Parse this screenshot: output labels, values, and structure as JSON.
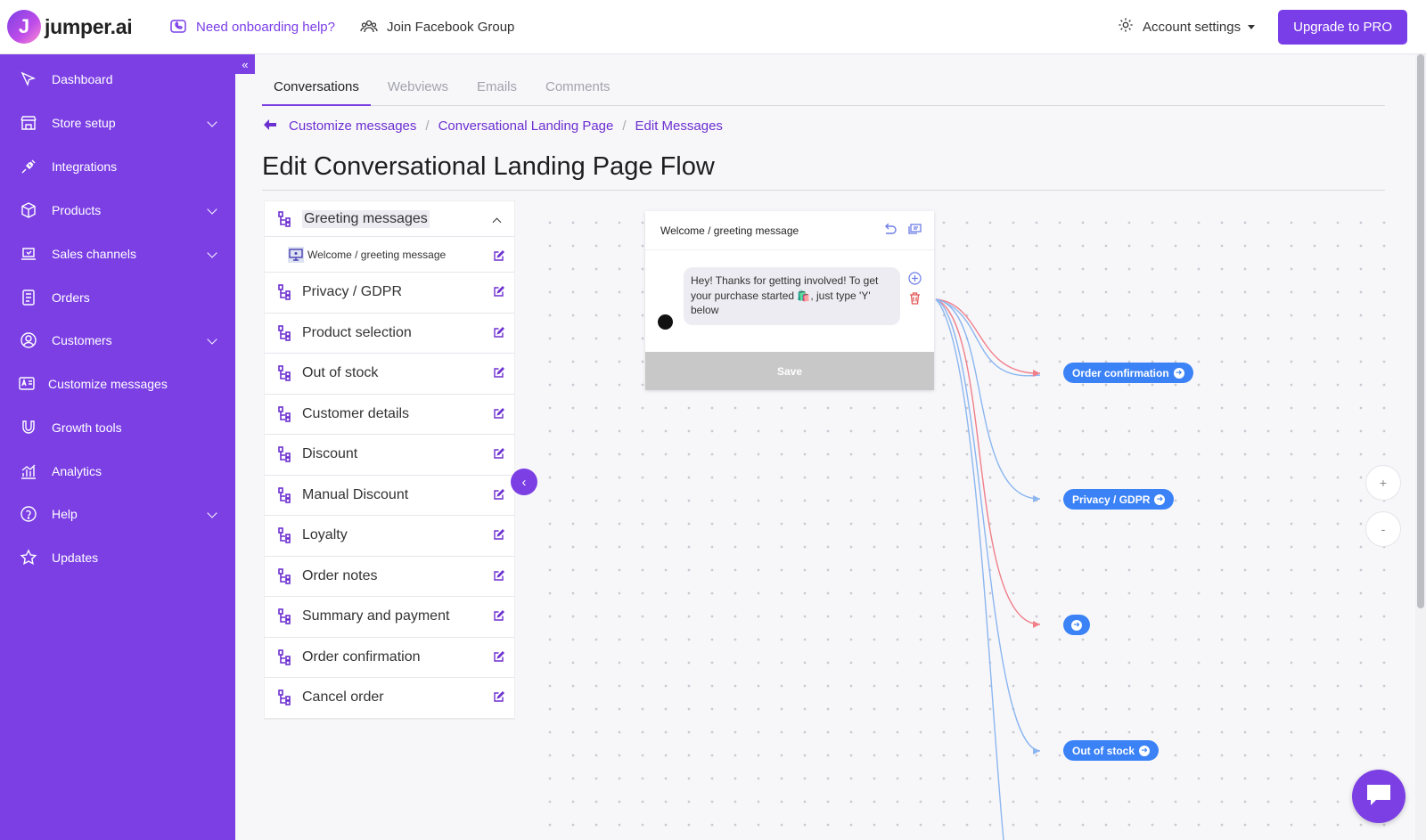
{
  "topbar": {
    "logo_text": "jumper.ai",
    "logo_letter": "J",
    "onboarding_link": "Need onboarding help?",
    "facebook_link": "Join Facebook Group",
    "account_settings": "Account settings",
    "upgrade_button": "Upgrade to PRO"
  },
  "sidebar": {
    "collapse_glyph": "«",
    "items": [
      {
        "label": "Dashboard",
        "icon": "dashboard-icon"
      },
      {
        "label": "Store setup",
        "icon": "store-icon"
      },
      {
        "label": "Integrations",
        "icon": "plug-icon"
      },
      {
        "label": "Products",
        "icon": "box-icon"
      },
      {
        "label": "Sales channels",
        "icon": "channels-icon"
      },
      {
        "label": "Orders",
        "icon": "orders-icon"
      },
      {
        "label": "Customers",
        "icon": "user-circle-icon"
      },
      {
        "label": "Customize messages",
        "icon": "message-edit-icon"
      },
      {
        "label": "Growth tools",
        "icon": "magnet-icon"
      },
      {
        "label": "Analytics",
        "icon": "analytics-icon"
      },
      {
        "label": "Help",
        "icon": "question-icon"
      },
      {
        "label": "Updates",
        "icon": "star-icon"
      }
    ]
  },
  "tabs": [
    {
      "label": "Conversations",
      "active": true
    },
    {
      "label": "Webviews",
      "active": false
    },
    {
      "label": "Emails",
      "active": false
    },
    {
      "label": "Comments",
      "active": false
    }
  ],
  "breadcrumb": [
    "Customize messages",
    "Conversational Landing Page",
    "Edit Messages"
  ],
  "page_title": "Edit Conversational Landing Page Flow",
  "flows": {
    "header": "Greeting messages",
    "sub_item": "Welcome / greeting message",
    "items": [
      "Privacy / GDPR",
      "Product selection",
      "Out of stock",
      "Customer details",
      "Discount",
      "Manual Discount",
      "Loyalty",
      "Order notes",
      "Summary and payment",
      "Order confirmation",
      "Cancel order"
    ]
  },
  "node": {
    "title": "Welcome / greeting message",
    "message": "Hey! Thanks for getting involved! To get your purchase started 🛍️, just type 'Y' below",
    "save_label": "Save"
  },
  "targets": {
    "order_confirmation": "Order confirmation",
    "privacy": "Privacy / GDPR",
    "unnamed": "",
    "out_of_stock": "Out of stock"
  },
  "zoom": {
    "plus": "+",
    "minus": "-"
  },
  "colors": {
    "brand": "#7b3fe4",
    "link_blue": "#3b82f6",
    "connector_red": "#f07f8a",
    "connector_blue": "#8cb6ef"
  }
}
